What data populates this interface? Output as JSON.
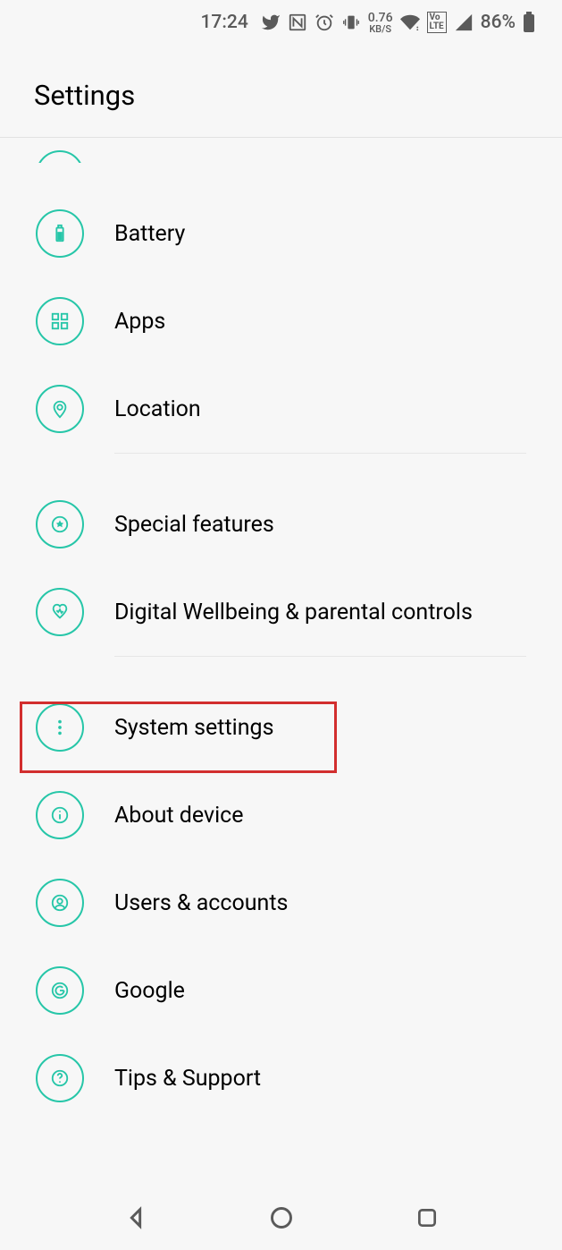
{
  "status": {
    "time": "17:24",
    "kbs_value": "0.76",
    "kbs_label": "KB/S",
    "volte": "Vo LTE",
    "battery_pct": "86%"
  },
  "header": {
    "title": "Settings"
  },
  "items": [
    {
      "icon": "battery",
      "label": "Battery"
    },
    {
      "icon": "apps",
      "label": "Apps"
    },
    {
      "icon": "location",
      "label": "Location"
    },
    {
      "icon": "special",
      "label": "Special features"
    },
    {
      "icon": "wellbeing",
      "label": "Digital Wellbeing & parental controls"
    },
    {
      "icon": "system",
      "label": "System settings",
      "highlighted": true
    },
    {
      "icon": "about",
      "label": "About device"
    },
    {
      "icon": "users",
      "label": "Users & accounts"
    },
    {
      "icon": "google",
      "label": "Google"
    },
    {
      "icon": "tips",
      "label": "Tips & Support"
    }
  ]
}
